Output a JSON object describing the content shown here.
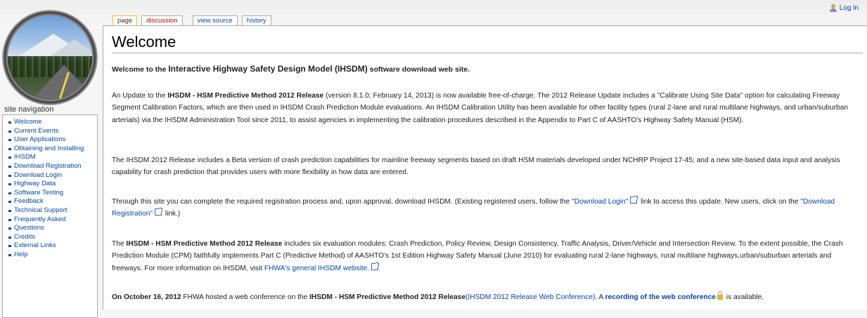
{
  "header": {
    "login": "Log in",
    "tabs": [
      "page",
      "discussion",
      "view source",
      "history"
    ]
  },
  "sidebar": {
    "title": "site navigation",
    "items": [
      "Welcome",
      "Current Events",
      "User Applications",
      "Obtaining and Installing",
      "IHSDM",
      "Download Registration",
      "Download Login",
      "Highway Data",
      "Software Testing",
      "Feedback",
      "Technical Support",
      "Frequently Asked",
      "Questions",
      "Credits",
      "External Links",
      "Help"
    ]
  },
  "main": {
    "title": "Welcome",
    "intro": {
      "pre": "Welcome to the ",
      "big": "Interactive Highway Safety Design Model (IHSDM)",
      "post": " software download web site."
    },
    "p1": {
      "a": "An Update to the ",
      "b": "IHSDM - HSM Predictive Method 2012 Release",
      "c": " (version 8.1.0; February 14, 2013) is now available free-of-charge. The 2012 Release Update includes a \"Calibrate Using Site Data\" option for calculating Freeway Segment Calibration Factors, which are then used in IHSDM Crash Prediction Module evaluations. An IHSDM Calibration Utility has been available for other facility types (rural 2-lane and rural multilane highways, and urban/suburban arterials) via the IHSDM Administration Tool since 2011, to assist agencies in implementing the calibration procedures described in the Appendix to Part C of AASHTO's Highway Safety Manual (HSM)."
    },
    "p2": "The IHSDM 2012 Release includes a Beta version of crash prediction capabilities for mainline freeway segments based on draft HSM materials developed under NCHRP Project 17-45; and a new site-based data input and analysis capability for crash prediction that provides users with more flexibility in how data are entered.",
    "p3": {
      "a": "Through this site you can complete the required registration process and, upon approval, download IHSDM. (Existing registered users, follow the ",
      "link1": "\"Download Login\"",
      "b": " link to access this update. New users, click on the ",
      "link2": "\"Download Registration\"",
      "c": " link.)"
    },
    "p4": {
      "a": "The ",
      "b": "IHSDM - HSM Predictive Method 2012 Release",
      "c": " includes six evaluation modules: Crash Prediction, Policy Review, Design Consistency, Traffic Analysis, Driver/Vehicle and Intersection Review. To the extent possible, the Crash Prediction Module (CPM) faithfully implements Part C (Predictive Method) of AASHTO's 1st Edition Highway Safety Manual (June 2010) for evaluating rural 2-lane highways, rural multilane highways,urban/suburban arterials and freeways. For more information on IHSDM, visit ",
      "link": "FHWA's general IHSDM website."
    },
    "p5": {
      "a": "On October 16, 2012",
      "b": " FHWA hosted a web conference on the ",
      "c": "IHSDM - HSM Predictive Method 2012 Release",
      "link1": "(IHSDM 2012 Release Web Conference)",
      "d": ". A ",
      "link2": "recording of the web conference",
      "e": " is available."
    }
  }
}
